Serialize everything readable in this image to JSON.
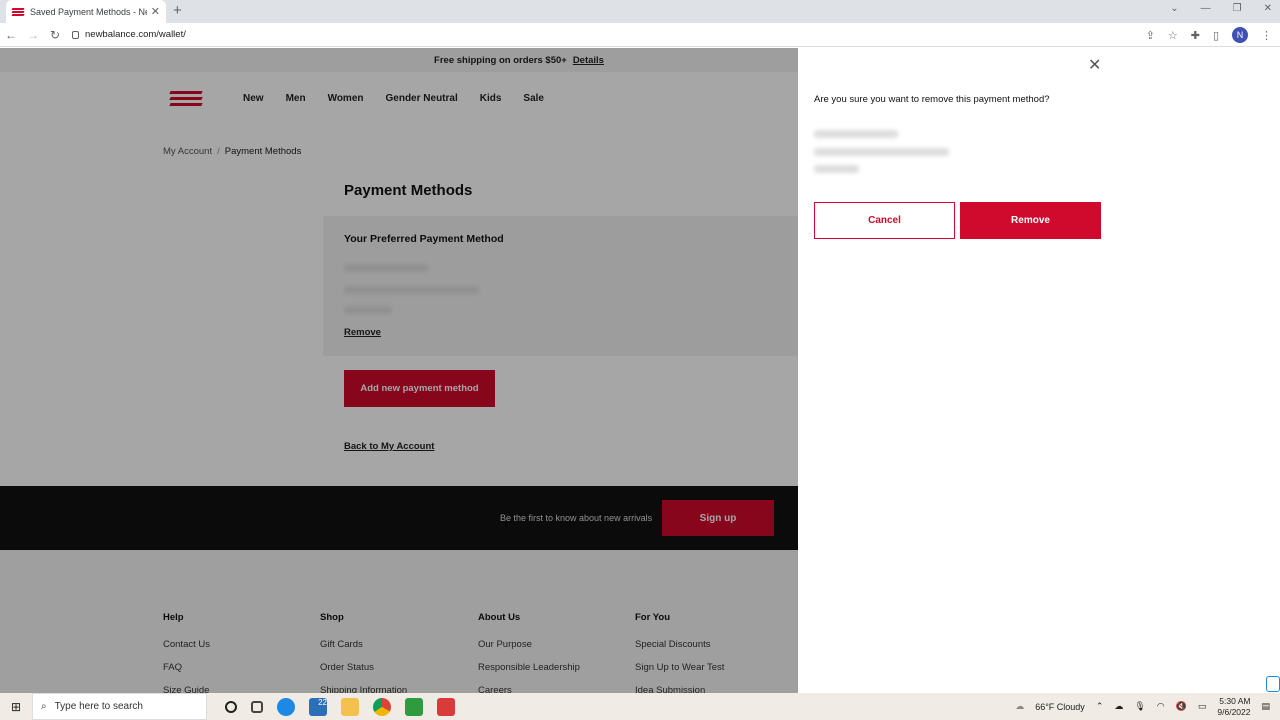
{
  "browser": {
    "tab_title": "Saved Payment Methods - New Balance",
    "url": "newbalance.com/wallet/",
    "profile_initial": "N"
  },
  "promo": {
    "text": "Free shipping on orders $50+",
    "link": "Details"
  },
  "nav": [
    "New",
    "Men",
    "Women",
    "Gender Neutral",
    "Kids",
    "Sale"
  ],
  "breadcrumb": {
    "parent": "My Account",
    "sep": "/",
    "current": "Payment Methods"
  },
  "page": {
    "title": "Payment Methods",
    "card_heading": "Your Preferred Payment Method",
    "remove_link": "Remove",
    "add_button": "Add new payment method",
    "back_link": "Back to My Account"
  },
  "newsletter": {
    "text": "Be the first to know about new arrivals",
    "button": "Sign up"
  },
  "footer": {
    "columns": [
      {
        "heading": "Help",
        "links": [
          "Contact Us",
          "FAQ",
          "Size Guide"
        ]
      },
      {
        "heading": "Shop",
        "links": [
          "Gift Cards",
          "Order Status",
          "Shipping Information"
        ]
      },
      {
        "heading": "About Us",
        "links": [
          "Our Purpose",
          "Responsible Leadership",
          "Careers"
        ]
      },
      {
        "heading": "For You",
        "links": [
          "Special Discounts",
          "Sign Up to Wear Test",
          "Idea Submission"
        ]
      }
    ]
  },
  "dialog": {
    "question": "Are you sure you want to remove this payment method?",
    "cancel": "Cancel",
    "remove": "Remove"
  },
  "taskbar": {
    "search_placeholder": "Type here to search",
    "weather": "66°F  Cloudy",
    "time": "5:30 AM",
    "date": "9/6/2022",
    "mail_badge": "22"
  },
  "colors": {
    "brand": "#cf0a2c",
    "overlay": "rgba(0,0,0,0.35)"
  }
}
